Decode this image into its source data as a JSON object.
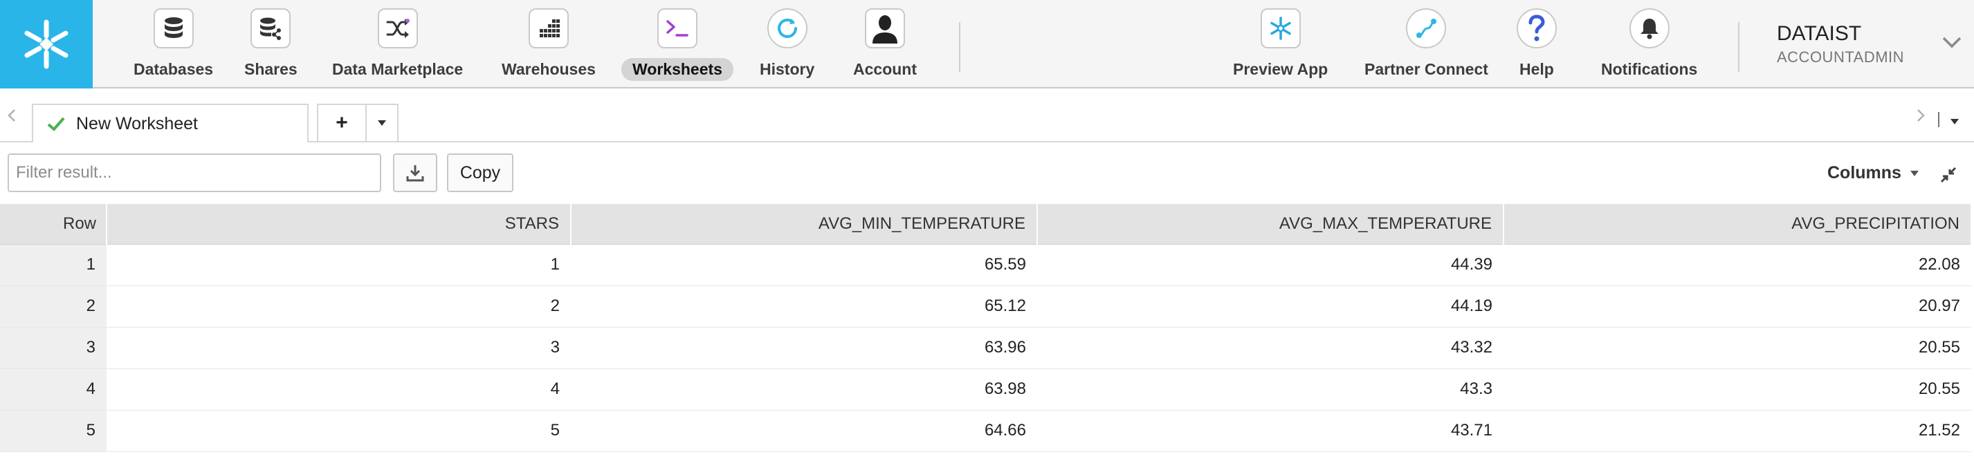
{
  "nav": {
    "items": [
      {
        "label": "Databases",
        "icon": "database-icon"
      },
      {
        "label": "Shares",
        "icon": "shares-icon"
      },
      {
        "label": "Data Marketplace",
        "icon": "marketplace-icon"
      },
      {
        "label": "Warehouses",
        "icon": "warehouse-icon"
      },
      {
        "label": "Worksheets",
        "icon": "terminal-icon",
        "active": true
      },
      {
        "label": "History",
        "icon": "history-icon"
      },
      {
        "label": "Account",
        "icon": "account-icon"
      }
    ],
    "right_items": [
      {
        "label": "Preview App",
        "icon": "snowflake-icon"
      },
      {
        "label": "Partner Connect",
        "icon": "partner-connect-icon"
      },
      {
        "label": "Help",
        "icon": "help-icon"
      },
      {
        "label": "Notifications",
        "icon": "bell-icon"
      }
    ],
    "account": {
      "name": "DATAIST",
      "role": "ACCOUNTADMIN"
    }
  },
  "tabs": {
    "items": [
      {
        "label": "New Worksheet"
      }
    ],
    "add_label": "+"
  },
  "toolbar": {
    "filter_placeholder": "Filter result...",
    "copy_label": "Copy",
    "columns_label": "Columns"
  },
  "results": {
    "columns": [
      "Row",
      "STARS",
      "AVG_MIN_TEMPERATURE",
      "AVG_MAX_TEMPERATURE",
      "AVG_PRECIPITATION"
    ],
    "rows": [
      [
        "1",
        "1",
        "65.59",
        "44.39",
        "22.08"
      ],
      [
        "2",
        "2",
        "65.12",
        "44.19",
        "20.97"
      ],
      [
        "3",
        "3",
        "63.96",
        "43.32",
        "20.55"
      ],
      [
        "4",
        "4",
        "63.98",
        "43.3",
        "20.55"
      ],
      [
        "5",
        "5",
        "64.66",
        "43.71",
        "21.52"
      ]
    ]
  },
  "colors": {
    "brand": "#29b5e8",
    "tab_check": "#4caf50",
    "active_nav_bg": "#d4d4d4"
  }
}
